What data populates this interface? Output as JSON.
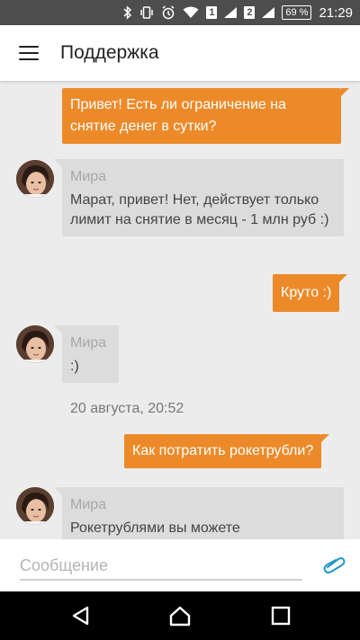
{
  "status_bar": {
    "sim1": "1",
    "sim2": "2",
    "battery": "69 %",
    "time": "21:29",
    "icons": [
      "bluetooth-icon",
      "vibrate-icon",
      "alarm-icon",
      "wifi-icon",
      "signal-icon",
      "battery-icon"
    ]
  },
  "app_bar": {
    "title": "Поддержка",
    "menu_icon": "menu-icon"
  },
  "messages": [
    {
      "direction": "out",
      "text": "Привет! Есть ли ограничение на снятие денег в сутки?"
    },
    {
      "direction": "in",
      "sender": "Мира",
      "text": "Марат, привет! Нет, действует только лимит на снятие в месяц - 1 млн руб :)"
    },
    {
      "direction": "out",
      "text": "Круто :)"
    },
    {
      "direction": "in",
      "sender": "Мира",
      "text": ":)"
    },
    {
      "direction": "separator",
      "text": "20 августа, 20:52"
    },
    {
      "direction": "out",
      "text": "Как потратить рокетрубли?"
    },
    {
      "direction": "in",
      "sender": "Мира",
      "text": "Рокетрублями вы можете"
    }
  ],
  "composer": {
    "placeholder": "Сообщение",
    "value": "",
    "attach_icon": "paperclip-icon"
  },
  "colors": {
    "accent": "#ec8a2a",
    "incoming_bubble": "#dcdcdc",
    "status_bar": "#4d4d4d",
    "background": "#ececec"
  },
  "nav_bar": {
    "icons": [
      "back-icon",
      "home-icon",
      "recents-icon"
    ]
  }
}
